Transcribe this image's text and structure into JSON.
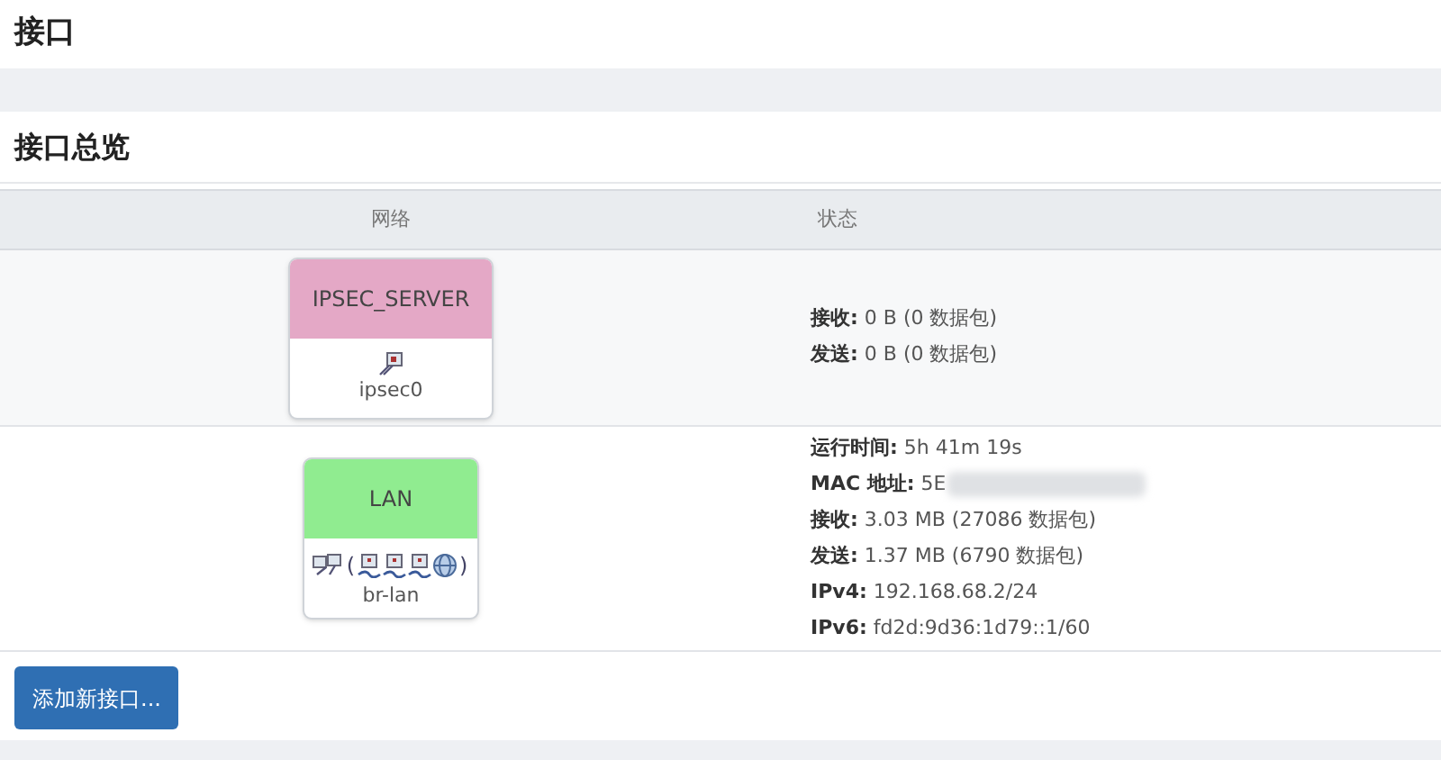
{
  "page_title": "接口",
  "section_title": "接口总览",
  "table": {
    "columns": [
      "网络",
      "状态"
    ],
    "rows": [
      {
        "name": "IPSEC_SERVER",
        "color": "#e4a8c6",
        "device": "ipsec0",
        "icons": [
          {
            "kind": "tunnel"
          }
        ],
        "status": [
          {
            "label": "接收:",
            "value": "0 B (0 数据包)"
          },
          {
            "label": "发送:",
            "value": "0 B (0 数据包)"
          }
        ]
      },
      {
        "name": "LAN",
        "color": "#90ec90",
        "device": "br-lan",
        "icons": [
          {
            "kind": "bridge"
          }
        ],
        "member_open": "(",
        "member_icons": [
          {
            "kind": "ethernet"
          },
          {
            "kind": "ethernet"
          },
          {
            "kind": "ethernet"
          },
          {
            "kind": "wireless"
          }
        ],
        "member_close": ")",
        "status": [
          {
            "label": "运行时间:",
            "value": "5h 41m 19s"
          },
          {
            "label": "MAC 地址:",
            "value": "5E",
            "redacted": true
          },
          {
            "label": "接收:",
            "value": "3.03 MB (27086 数据包)"
          },
          {
            "label": "发送:",
            "value": "1.37 MB (6790 数据包)"
          },
          {
            "label": "IPv4:",
            "value": "192.168.68.2/24"
          },
          {
            "label": "IPv6:",
            "value": "fd2d:9d36:1d79::1/60"
          }
        ]
      }
    ]
  },
  "add_button": "添加新接口..."
}
